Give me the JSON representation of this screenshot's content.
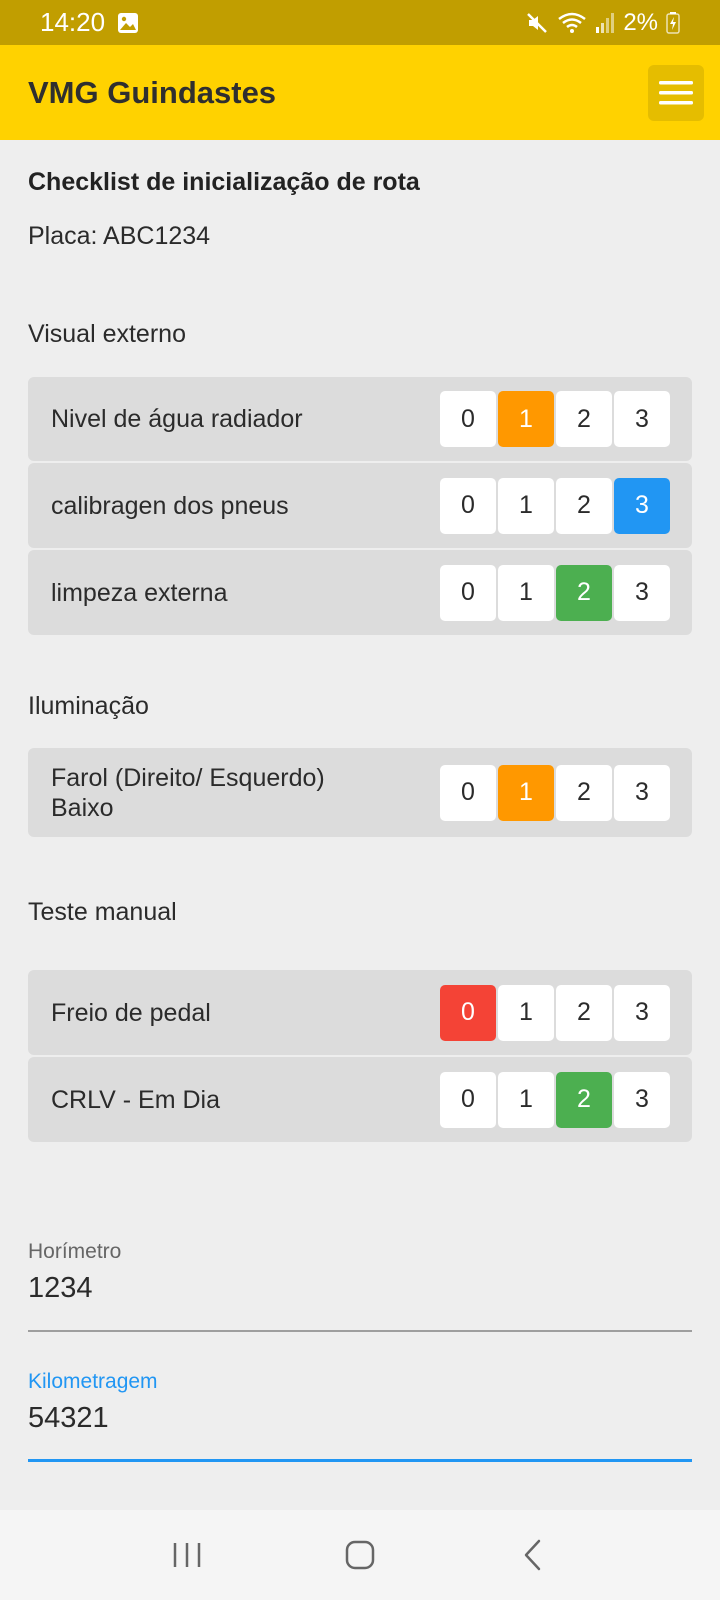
{
  "status_bar": {
    "time": "14:20",
    "battery": "2%"
  },
  "app_bar": {
    "title": "VMG Guindastes"
  },
  "page": {
    "title": "Checklist de inicialização de rota",
    "plate": "Placa: ABC1234"
  },
  "sections": [
    {
      "title": "Visual externo",
      "items": [
        {
          "label": "Nivel de água radiador",
          "options": [
            "0",
            "1",
            "2",
            "3"
          ],
          "selected": "1",
          "selected_color": "#ff9800"
        },
        {
          "label": "calibragen dos pneus",
          "options": [
            "0",
            "1",
            "2",
            "3"
          ],
          "selected": "3",
          "selected_color": "#2196f3"
        },
        {
          "label": "limpeza externa",
          "options": [
            "0",
            "1",
            "2",
            "3"
          ],
          "selected": "2",
          "selected_color": "#4caf50"
        }
      ]
    },
    {
      "title": "Iluminação",
      "items": [
        {
          "label": "Farol (Direito/ Esquerdo) Baixo",
          "options": [
            "0",
            "1",
            "2",
            "3"
          ],
          "selected": "1",
          "selected_color": "#ff9800"
        }
      ]
    },
    {
      "title": "Teste manual",
      "items": [
        {
          "label": "Freio de pedal",
          "options": [
            "0",
            "1",
            "2",
            "3"
          ],
          "selected": "0",
          "selected_color": "#f44336"
        },
        {
          "label": "CRLV - Em Dia",
          "options": [
            "0",
            "1",
            "2",
            "3"
          ],
          "selected": "2",
          "selected_color": "#4caf50"
        }
      ]
    }
  ],
  "fields": {
    "horimetro": {
      "label": "Horímetro",
      "value": "1234"
    },
    "kilometragem": {
      "label": "Kilometragem",
      "value": "54321",
      "focused": true
    }
  },
  "icons": {
    "menu": "hamburger-icon",
    "nav_recent": "recent-apps-icon",
    "nav_home": "home-icon",
    "nav_back": "back-icon"
  },
  "colors": {
    "status_bar": "#c19e00",
    "app_bar": "#ffd200",
    "accent": "#2196f3"
  }
}
